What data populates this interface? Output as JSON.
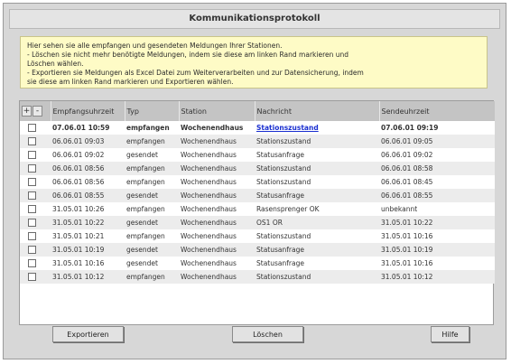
{
  "title": "Kommunikationsprotokoll",
  "info_lines": [
    "Hier sehen sie alle empfangen und gesendeten Meldungen Ihrer Stationen.",
    "- Löschen sie nicht mehr benötigte Meldungen, indem sie diese am linken Rand markieren und",
    "Löschen wählen.",
    "- Exportieren sie Meldungen als Excel Datei zum Weiterverarbeiten und zur Datensicherung, indem",
    "sie diese am linken Rand markieren und Exportieren wählen."
  ],
  "table": {
    "plus_label": "+",
    "minus_label": "-",
    "columns": [
      "Empfangsuhrzeit",
      "Typ",
      "Station",
      "Nachricht",
      "Sendeuhrzeit"
    ],
    "rows": [
      {
        "empf": "07.06.01 10:59",
        "typ": "empfangen",
        "station": "Wochenendhaus",
        "nachricht": "Stationszustand",
        "send": "07.06.01 09:19",
        "bold": true,
        "link": true
      },
      {
        "empf": "06.06.01 09:03",
        "typ": "empfangen",
        "station": "Wochenendhaus",
        "nachricht": "Stationszustand",
        "send": "06.06.01 09:05"
      },
      {
        "empf": "06.06.01 09:02",
        "typ": "gesendet",
        "station": "Wochenendhaus",
        "nachricht": "Statusanfrage",
        "send": "06.06.01 09:02"
      },
      {
        "empf": "06.06.01 08:56",
        "typ": "empfangen",
        "station": "Wochenendhaus",
        "nachricht": "Stationszustand",
        "send": "06.06.01 08:58"
      },
      {
        "empf": "06.06.01 08:56",
        "typ": "empfangen",
        "station": "Wochenendhaus",
        "nachricht": "Stationszustand",
        "send": "06.06.01 08:45"
      },
      {
        "empf": "06.06.01 08:55",
        "typ": "gesendet",
        "station": "Wochenendhaus",
        "nachricht": "Statusanfrage",
        "send": "06.06.01 08:55"
      },
      {
        "empf": "31.05.01 10:26",
        "typ": "empfangen",
        "station": "Wochenendhaus",
        "nachricht": "Rasensprenger OK",
        "send": "unbekannt"
      },
      {
        "empf": "31.05.01 10:22",
        "typ": "gesendet",
        "station": "Wochenendhaus",
        "nachricht": "OS1 OR",
        "send": "31.05.01 10:22"
      },
      {
        "empf": "31.05.01 10:21",
        "typ": "empfangen",
        "station": "Wochenendhaus",
        "nachricht": "Stationszustand",
        "send": "31.05.01 10:16"
      },
      {
        "empf": "31.05.01 10:19",
        "typ": "gesendet",
        "station": "Wochenendhaus",
        "nachricht": "Statusanfrage",
        "send": "31.05.01 10:19"
      },
      {
        "empf": "31.05.01 10:16",
        "typ": "gesendet",
        "station": "Wochenendhaus",
        "nachricht": "Statusanfrage",
        "send": "31.05.01 10:16"
      },
      {
        "empf": "31.05.01 10:12",
        "typ": "empfangen",
        "station": "Wochenendhaus",
        "nachricht": "Stationszustand",
        "send": "31.05.01 10:12"
      }
    ]
  },
  "buttons": {
    "export": "Exportieren",
    "delete": "Löschen",
    "help": "Hilfe"
  }
}
